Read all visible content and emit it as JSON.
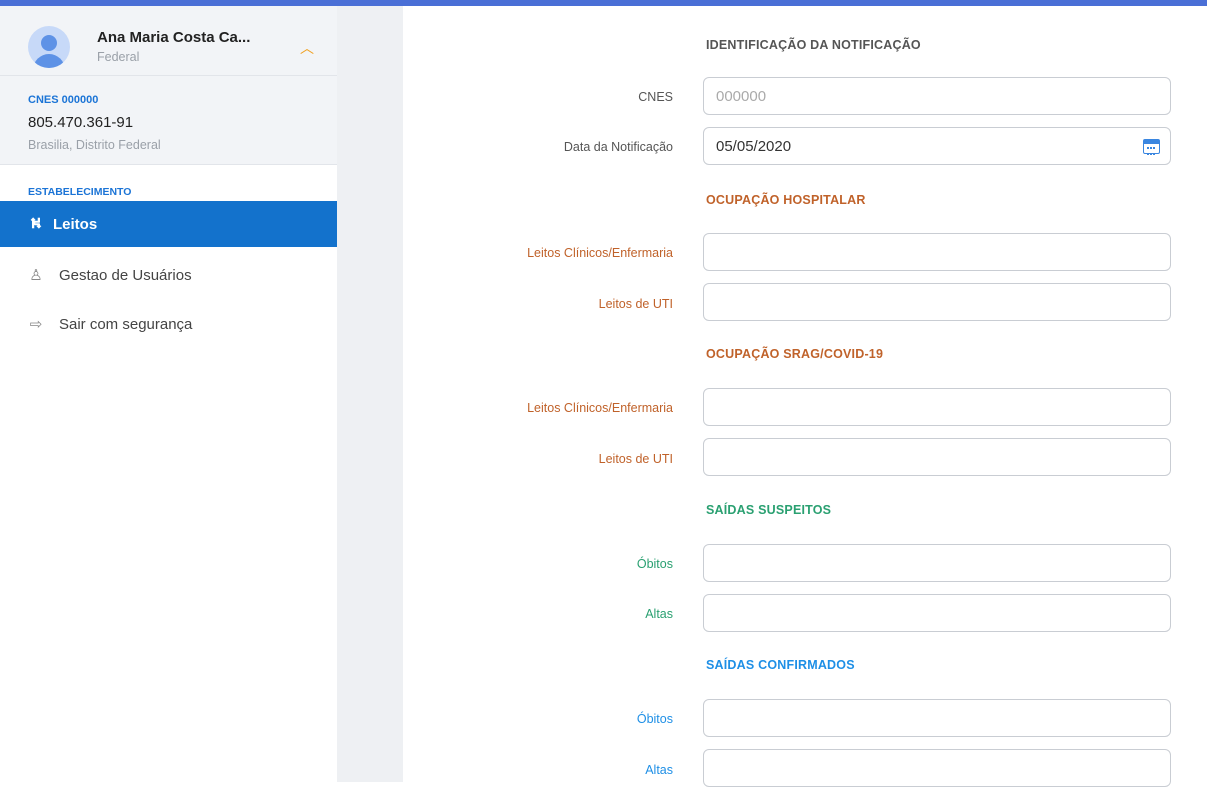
{
  "user": {
    "name": "Ana Maria Costa Ca...",
    "role": "Federal"
  },
  "establishment": {
    "cnes": "CNES 000000",
    "cpf": "805.470.361-91",
    "city": "Brasilia, Distrito Federal"
  },
  "sidebar": {
    "section": "ESTABELECIMENTO",
    "items": [
      {
        "label": "Leitos",
        "icon": "bed-icon",
        "active": true
      },
      {
        "label": "Gestao de Usuários",
        "icon": "users-icon",
        "active": false
      },
      {
        "label": "Sair com segurança",
        "icon": "logout-icon",
        "active": false
      }
    ]
  },
  "form": {
    "identificacao": {
      "title": "IDENTIFICAÇÃO DA NOTIFICAÇÃO",
      "cnes_label": "CNES",
      "cnes_placeholder": "000000",
      "date_label": "Data da Notificação",
      "date_value": "05/05/2020"
    },
    "ocupacao_hospitalar": {
      "title": "OCUPAÇÃO HOSPITALAR",
      "clinicos_label": "Leitos Clínicos/Enfermaria",
      "uti_label": "Leitos de UTI"
    },
    "ocupacao_srag": {
      "title": "OCUPAÇÃO SRAG/COVID-19",
      "clinicos_label": "Leitos Clínicos/Enfermaria",
      "uti_label": "Leitos de UTI"
    },
    "saidas_suspeitos": {
      "title": "SAÍDAS SUSPEITOS",
      "obitos_label": "Óbitos",
      "altas_label": "Altas"
    },
    "saidas_confirmados": {
      "title": "SAÍDAS CONFIRMADOS",
      "obitos_label": "Óbitos",
      "altas_label": "Altas"
    }
  },
  "colors": {
    "accent": "#1372cc",
    "orange": "#c0622a",
    "green": "#2aa071",
    "blue": "#1e8fe6"
  }
}
